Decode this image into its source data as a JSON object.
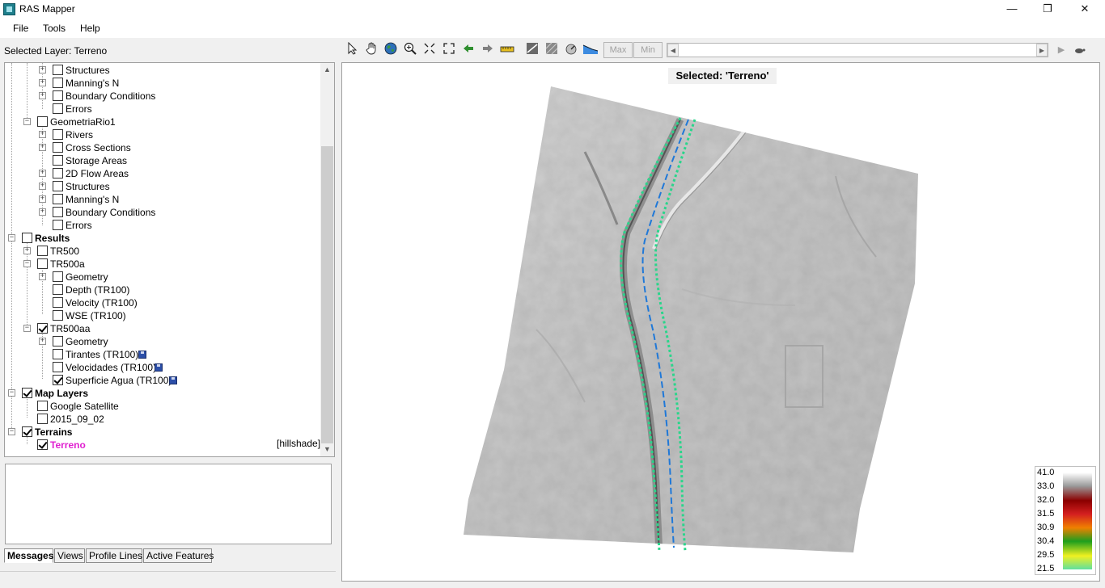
{
  "window": {
    "title": "RAS Mapper",
    "minimize": "—",
    "restore": "❐",
    "close": "✕"
  },
  "menu": {
    "file": "File",
    "tools": "Tools",
    "help": "Help"
  },
  "selected_layer_label": "Selected Layer: Terreno",
  "tree": {
    "structures_a": "Structures",
    "mannings_a": "Manning's N",
    "boundary_a": "Boundary Conditions",
    "errors_a": "Errors",
    "geometria": "GeometriaRio1",
    "rivers": "Rivers",
    "cross_sections": "Cross Sections",
    "storage_areas": "Storage Areas",
    "flow_areas": "2D Flow Areas",
    "structures_b": "Structures",
    "mannings_b": "Manning's N",
    "boundary_b": "Boundary Conditions",
    "errors_b": "Errors",
    "results": "Results",
    "tr500": "TR500",
    "tr500a": "TR500a",
    "geometry_a": "Geometry",
    "depth": "Depth (TR100)",
    "velocity": "Velocity (TR100)",
    "wse": "WSE (TR100)",
    "tr500aa": "TR500aa",
    "geometry_b": "Geometry",
    "tirantes": "Tirantes (TR100)",
    "velocidades": "Velocidades (TR100)",
    "superficie": "Superficie Agua (TR100)",
    "map_layers": "Map Layers",
    "google": "Google Satellite",
    "date_layer": "2015_09_02",
    "terrains": "Terrains",
    "terreno": "Terreno",
    "hillshade": "[hillshade]"
  },
  "tabs": {
    "messages": "Messages",
    "views": "Views",
    "profile_lines": "Profile Lines",
    "active_features": "Active Features"
  },
  "toolbar": {
    "max": "Max",
    "min": "Min"
  },
  "map": {
    "selected_badge": "Selected: 'Terreno'"
  },
  "legend": {
    "values": [
      "41.0",
      "33.0",
      "32.0",
      "31.5",
      "30.9",
      "30.4",
      "29.5",
      "21.5"
    ],
    "colors": [
      "#ffffff",
      "#9a9a9a",
      "#8b0000",
      "#d42020",
      "#f08000",
      "#1e9e1e",
      "#f0f020",
      "#60e0a0"
    ]
  },
  "colors": {
    "terrain_layer": "#e020d0",
    "river_left_bank": "#2ad58b",
    "river_centerline": "#1f78d8"
  }
}
